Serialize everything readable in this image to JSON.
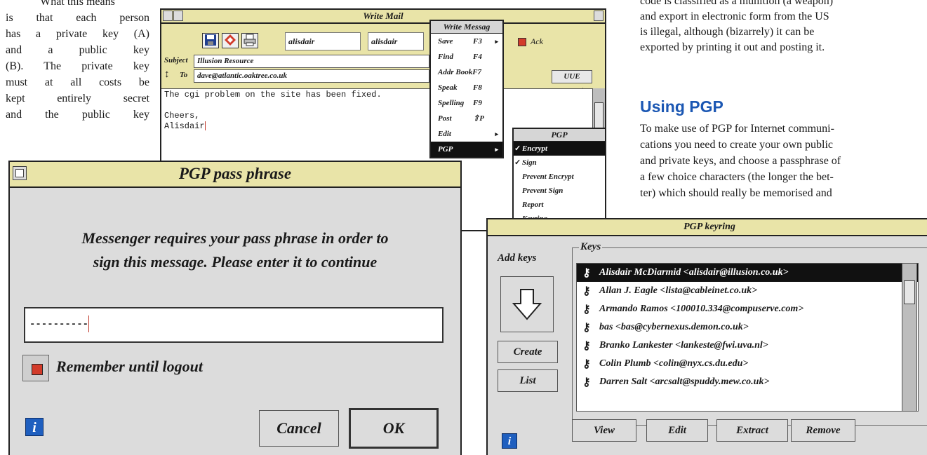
{
  "article": {
    "left_column": [
      "What this means",
      "is that each person",
      "has a private key (A)",
      "and a public key",
      "(B). The private key",
      "must at all costs be",
      "kept entirely secret",
      "and the public key"
    ],
    "right_column_top": [
      "code is classified as a munition (a weapon)",
      "and export in electronic form from the US",
      "is illegal, although (bizarrely) it can be",
      "exported by printing it out and posting it."
    ],
    "heading": "Using PGP",
    "right_column_bottom": [
      "To make use of PGP for Internet communi-",
      "cations you need to create your own public",
      "and private keys, and choose a passphrase of",
      "a few choice characters (the longer the bet-",
      "ter) which should really be memorised and"
    ]
  },
  "write_mail": {
    "title": "Write Mail",
    "from_1": "alisdair",
    "from_2": "alisdair",
    "ack_label": "Ack",
    "subject_label": "Subject",
    "subject_value": "Illusion Resource",
    "to_label": "To",
    "to_value": "dave@atlantic.oaktree.co.uk",
    "encoding": "UUE",
    "body_line1": "The cgi problem on the site has been fixed.",
    "body_line2": "",
    "body_line3": "Cheers,",
    "body_line4": "Alisdair"
  },
  "menu_write": {
    "title": "Write Messag",
    "items": [
      {
        "label": "Save",
        "key": "F3"
      },
      {
        "label": "Find",
        "key": "F4"
      },
      {
        "label": "Addr Book",
        "key": "F7"
      },
      {
        "label": "Speak",
        "key": "F8"
      },
      {
        "label": "Spelling",
        "key": "F9"
      },
      {
        "label": "Post",
        "key": "⇧P"
      },
      {
        "label": "Edit",
        "key": ""
      },
      {
        "label": "PGP",
        "key": ""
      }
    ]
  },
  "menu_pgp": {
    "title": "PGP",
    "items": [
      "Encrypt",
      "Sign",
      "Prevent Encrypt",
      "Prevent Sign",
      "Report",
      "Keyring"
    ]
  },
  "pass_phrase": {
    "title": "PGP pass phrase",
    "message_line1": "Messenger requires your pass phrase in order to",
    "message_line2": "sign this message.  Please enter it to continue",
    "input_value": "----------",
    "remember_label": "Remember until logout",
    "info_icon": "i",
    "cancel_label": "Cancel",
    "ok_label": "OK"
  },
  "keyring": {
    "title": "PGP keyring",
    "add_keys_label": "Add keys",
    "keys_label": "Keys",
    "create_label": "Create",
    "list_label": "List",
    "info_icon": "i",
    "keys": [
      "Alisdair McDiarmid <alisdair@illusion.co.uk>",
      "Allan J. Eagle <lista@cableinet.co.uk>",
      "Armando Ramos <100010.334@compuserve.com>",
      "bas <bas@cybernexus.demon.co.uk>",
      "Branko Lankester  <lankeste@fwi.uva.nl>",
      "Colin Plumb <colin@nyx.cs.du.edu>",
      "Darren Salt <arcsalt@spuddy.mew.co.uk>"
    ],
    "view_label": "View",
    "edit_label": "Edit",
    "extract_label": "Extract",
    "remove_label": "Remove"
  },
  "colors": {
    "titlebar": "#e9e4a8",
    "heading": "#1b57b3",
    "info_icon": "#1f5fbf",
    "checkbox_red": "#d23b2a"
  }
}
